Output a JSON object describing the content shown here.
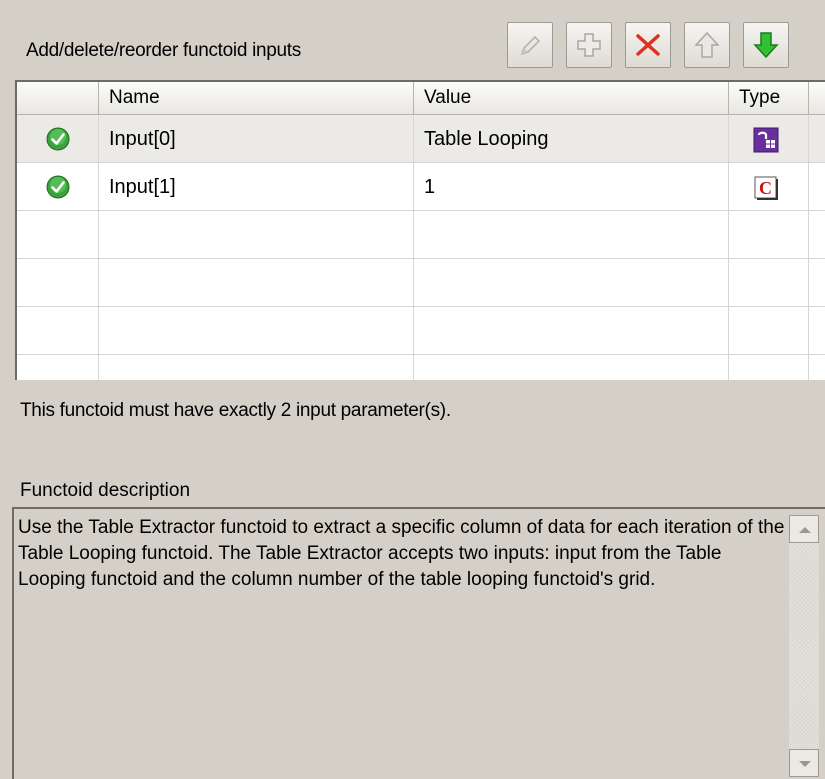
{
  "header": {
    "title": "Add/delete/reorder functoid inputs"
  },
  "toolbar": {
    "buttons": [
      {
        "name": "edit",
        "icon": "pencil-icon",
        "enabled": false
      },
      {
        "name": "add",
        "icon": "plus-icon",
        "enabled": false
      },
      {
        "name": "delete",
        "icon": "red-x-icon",
        "enabled": true
      },
      {
        "name": "move-up",
        "icon": "up-arrow-icon",
        "enabled": false
      },
      {
        "name": "move-down",
        "icon": "down-arrow-icon",
        "enabled": true
      }
    ]
  },
  "grid": {
    "columns": [
      "Name",
      "Value",
      "Type"
    ],
    "rows": [
      {
        "name": "Input[0]",
        "value": "Table Looping",
        "type_icon": "link-type-icon",
        "valid": true,
        "selected": true
      },
      {
        "name": "Input[1]",
        "value": "1",
        "type_icon": "constant-type-icon",
        "valid": true,
        "selected": false
      }
    ]
  },
  "messages": {
    "param_count": "This functoid must have exactly 2 input parameter(s)."
  },
  "description": {
    "label": "Functoid description",
    "text": "Use the Table Extractor functoid to extract a specific column of data for each iteration of the Table Looping functoid. The Table Extractor accepts two inputs: input from the Table Looping functoid and the column number of the table looping functoid's grid."
  },
  "colors": {
    "panel_bg": "#d4d0c8",
    "check_green": "#3aa33a",
    "delete_red": "#e03020",
    "down_green": "#2eb82e",
    "type_purple": "#6a2f9e",
    "constant_red": "#cc1010"
  }
}
